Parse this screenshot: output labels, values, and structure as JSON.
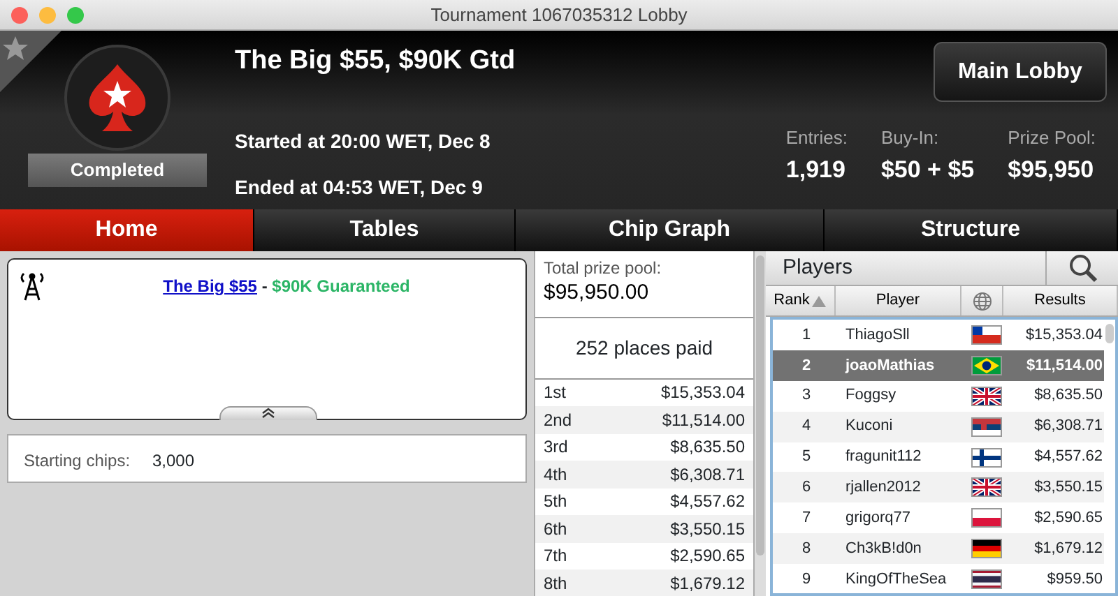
{
  "window": {
    "title": "Tournament 1067035312 Lobby"
  },
  "header": {
    "title": "The Big $55, $90K Gtd",
    "status": "Completed",
    "started": "Started at 20:00 WET, Dec 8",
    "ended": "Ended at 04:53 WET, Dec 9",
    "main_lobby_button": "Main Lobby",
    "stats": [
      {
        "label": "Entries:",
        "value": "1,919"
      },
      {
        "label": "Buy-In:",
        "value": "$50 + $5"
      },
      {
        "label": "Prize Pool:",
        "value": "$95,950"
      }
    ]
  },
  "tabs": [
    {
      "label": "Home",
      "selected": true
    },
    {
      "label": "Tables",
      "selected": false
    },
    {
      "label": "Chip Graph",
      "selected": false
    },
    {
      "label": "Structure",
      "selected": false
    }
  ],
  "news": {
    "headline_link": "The Big $55",
    "separator": " - ",
    "headline": "$90K Guaranteed"
  },
  "starting_chips": {
    "label": "Starting chips:",
    "value": "3,000"
  },
  "prizes": {
    "total_label": "Total prize pool:",
    "total": "$95,950.00",
    "places_paid": "252 places paid",
    "rows": [
      {
        "place": "1st",
        "amount": "$15,353.04"
      },
      {
        "place": "2nd",
        "amount": "$11,514.00"
      },
      {
        "place": "3rd",
        "amount": "$8,635.50"
      },
      {
        "place": "4th",
        "amount": "$6,308.71"
      },
      {
        "place": "5th",
        "amount": "$4,557.62"
      },
      {
        "place": "6th",
        "amount": "$3,550.15"
      },
      {
        "place": "7th",
        "amount": "$2,590.65"
      },
      {
        "place": "8th",
        "amount": "$1,679.12"
      }
    ]
  },
  "players": {
    "title": "Players",
    "columns": [
      {
        "kind": "text",
        "label": "Rank",
        "sorted": true
      },
      {
        "kind": "text",
        "label": "Player",
        "sorted": false
      },
      {
        "kind": "globe"
      },
      {
        "kind": "text",
        "label": "Results",
        "sorted": false
      }
    ],
    "rows": [
      {
        "rank": "1",
        "player": "ThiagoSll",
        "kind": "chile",
        "result": "$15,353.04",
        "selected": false
      },
      {
        "rank": "2",
        "player": "joaoMathias",
        "kind": "brazil",
        "result": "$11,514.00",
        "selected": true
      },
      {
        "rank": "3",
        "player": "Foggsy",
        "kind": "uk",
        "result": "$8,635.50",
        "selected": false
      },
      {
        "rank": "4",
        "player": "Kuconi",
        "kind": "serbia",
        "result": "$6,308.71",
        "selected": false
      },
      {
        "rank": "5",
        "player": "fragunit112",
        "kind": "finland",
        "result": "$4,557.62",
        "selected": false
      },
      {
        "rank": "6",
        "player": "rjallen2012",
        "kind": "uk",
        "result": "$3,550.15",
        "selected": false
      },
      {
        "rank": "7",
        "player": "grigorq77",
        "kind": "poland",
        "result": "$2,590.65",
        "selected": false
      },
      {
        "rank": "8",
        "player": "Ch3kB!d0n",
        "kind": "germany",
        "result": "$1,679.12",
        "selected": false
      },
      {
        "rank": "9",
        "player": "KingOfTheSea",
        "kind": "thailand",
        "result": "$959.50",
        "selected": false
      }
    ]
  }
}
